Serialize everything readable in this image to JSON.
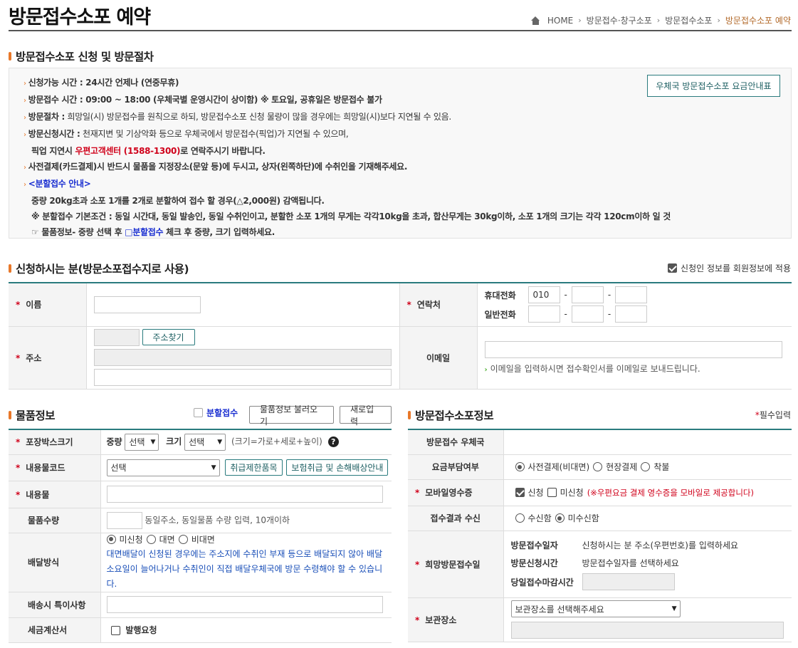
{
  "page": {
    "title": "방문접수소포 예약"
  },
  "breadcrumb": {
    "home": "HOME",
    "level1": "방문접수·창구소포",
    "level2": "방문접수소포",
    "current": "방문접수소포 예약"
  },
  "notice": {
    "section_title": "방문접수소포 신청 및 방문절차",
    "fee_button": "우체국 방문접수소포 요금안내표",
    "line1": "신청가능 시간 : 24시간 언제나 (연중무휴)",
    "line2": "방문접수 시간 : 09:00 ~ 18:00 (우체국별 운영시간이 상이함) ※ 토요일, 공휴일은 방문접수 불가",
    "line3_label": "방문절차 :",
    "line3_text": " 희망일(시) 방문접수를 원칙으로 하되, 방문접수소포 신청 물량이 많을 경우에는 희망일(시)보다 지연될 수 있음.",
    "line4_label": "방문신청시간 :",
    "line4_text": " 천재지변 및 기상악화 등으로 우체국에서 방문접수(픽업)가 지연될 수 있으며,",
    "line4b_pre": "픽업 지연시 ",
    "line4b_red": "우편고객센터 (1588-1300)",
    "line4b_post": "로 연락주시기 바랍니다.",
    "line5": "사전결제(카드결제)시 반드시 물품을 지정장소(문앞 등)에 두시고, 상자(왼쪽하단)에 수취인을 기재해주세요.",
    "line6": "<분할접수 안내>",
    "line7": "중량 20kg초과 소포 1개를 2개로 분할하여 접수 할 경우(△2,000원) 감액됩니다.",
    "line8": "※ 분할접수 기본조건 : 동일 시간대, 동일 발송인, 동일 수취인이고, 분할한 소포 1개의 무게는 각각10kg을 초과, 합산무게는 30kg이하, 소포 1개의 크기는 각각 120cm이하 일 것",
    "line9_pre": "☞ 물품정보- 중량 선택 후 ",
    "line9_blue": "□분할접수",
    "line9_post": " 체크 후 중량, 크기 입력하세요."
  },
  "applicant": {
    "section_title": "신청하시는 분(방문소포접수지로 사용)",
    "member_check_label": "신청인 정보를 회원정보에 적용",
    "name_label": "이름",
    "contact_label": "연락처",
    "mobile_label": "휴대전화",
    "mobile_prefix": "010",
    "phone_label": "일반전화",
    "dash": "-",
    "address_label": "주소",
    "address_button": "주소찾기",
    "email_label": "이메일",
    "email_note": "이메일을 입력하시면 접수확인서를 이메일로 보내드립니다."
  },
  "goods": {
    "section_title": "물품정보",
    "split_label": "분할접수",
    "load_button": "물품정보 불러오기",
    "reset_button": "새로입력",
    "box_size_label": "포장박스크기",
    "weight_label": "중량",
    "weight_value": "선택",
    "size_label": "크기",
    "size_value": "선택",
    "size_hint": "(크기=가로+세로+높이)",
    "help": "?",
    "code_label": "내용물코드",
    "code_value": "선택",
    "restrict_button": "취급제한품목",
    "insurance_button": "보험취급 및 손해배상안내",
    "content_label": "내용물",
    "qty_label": "물품수량",
    "qty_hint": "동일주소, 동일물품 수량 입력, 10개이하",
    "delivery_label": "배달방식",
    "delivery_opt1": "미신청",
    "delivery_opt2": "대면",
    "delivery_opt3": "비대면",
    "delivery_note": "대면배달이 신청된 경우에는 주소지에 수취인 부재 등으로 배달되지 않아 배달 소요일이 늘어나거나 수취인이 직접 배달우체국에 방문 수령해야 할 수 있습니다.",
    "special_label": "배송시 특이사항",
    "tax_label": "세금계산서",
    "tax_check": "발행요청"
  },
  "visit": {
    "section_title": "방문접수소포정보",
    "required_mark": "*",
    "required_text": "필수입력",
    "office_label": "방문접수 우체국",
    "fee_label": "요금부담여부",
    "fee_opt1": "사전결제(비대면)",
    "fee_opt2": "현장결제",
    "fee_opt3": "착불",
    "receipt_label": "모바일영수증",
    "receipt_opt1": "신청",
    "receipt_opt2": "미신청",
    "receipt_note": "(※우편요금 결제 영수증을 모바일로 제공합니다)",
    "result_label": "접수결과 수신",
    "result_opt1": "수신함",
    "result_opt2": "미수신함",
    "hope_label": "희망방문접수일",
    "visit_date_label": "방문접수일자",
    "visit_date_text": "신청하시는 분 주소(우편번호)를 입력하세요",
    "visit_time_label": "방문신청시간",
    "visit_time_text": "방문접수일자를 선택하세요",
    "deadline_label": "당일접수마감시간",
    "storage_label": "보관장소",
    "storage_placeholder": "보관장소를 선택해주세요"
  }
}
